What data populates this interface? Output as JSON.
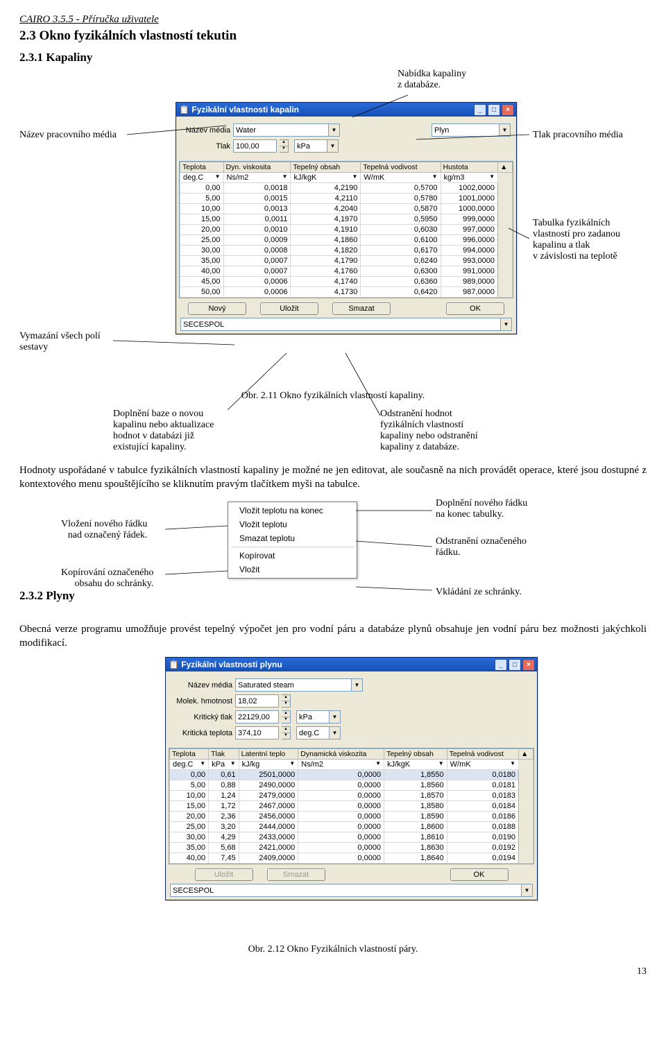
{
  "header": "CAIRO 3.5.5  - Příručka uživatele",
  "section_title": "2.3 Okno fyzikálních vlastností tekutin",
  "subsection_title": "2.3.1 Kapaliny",
  "callouts1": {
    "nabidka": "Nabídka kapaliny\nz databáze.",
    "nazev": "Název pracovního média",
    "tlak": "Tlak pracovního média",
    "tabulka": "Tabulka fyzikálních\nvlastností pro zadanou\nkapalinu a tlak\nv závislosti na teplotě",
    "vymazani": "Vymazání všech polí\nsestavy",
    "doplneni": "Doplnění baze o novou\nkapalinu nebo aktualizace\nhodnot v databázi již\nexistující kapaliny.",
    "odstraneni": "Odstranění hodnot\nfyzikálních vlastností\nkapaliny nebo odstranění\nkapaliny z databáze."
  },
  "win1": {
    "title": "Fyzikální vlastnosti kapalin",
    "nazev_lbl": "Název média",
    "nazev_val": "Water",
    "plyn_lbl": "Plyn",
    "tlak_lbl": "Tlak",
    "tlak_val": "100,00",
    "tlak_unit": "kPa",
    "cols": [
      "Teplota",
      "Dyn. viskosita",
      "Tepelný obsah",
      "Tepelná vodivost",
      "Hustota"
    ],
    "units": [
      "deg.C",
      "Ns/m2",
      "kJ/kgK",
      "W/mK",
      "kg/m3"
    ],
    "rows": [
      [
        "0,00",
        "0,0018",
        "4,2190",
        "0,5700",
        "1002,0000"
      ],
      [
        "5,00",
        "0,0015",
        "4,2110",
        "0,5780",
        "1001,0000"
      ],
      [
        "10,00",
        "0,0013",
        "4,2040",
        "0,5870",
        "1000,0000"
      ],
      [
        "15,00",
        "0,0011",
        "4,1970",
        "0,5950",
        "999,0000"
      ],
      [
        "20,00",
        "0,0010",
        "4,1910",
        "0,6030",
        "997,0000"
      ],
      [
        "25,00",
        "0,0009",
        "4,1860",
        "0,6100",
        "996,0000"
      ],
      [
        "30,00",
        "0,0008",
        "4,1820",
        "0,6170",
        "994,0000"
      ],
      [
        "35,00",
        "0,0007",
        "4,1790",
        "0,6240",
        "993,0000"
      ],
      [
        "40,00",
        "0,0007",
        "4,1760",
        "0,6300",
        "991,0000"
      ],
      [
        "45,00",
        "0,0006",
        "4,1740",
        "0,6360",
        "989,0000"
      ],
      [
        "50,00",
        "0,0006",
        "4,1730",
        "0,6420",
        "987,0000"
      ]
    ],
    "btn_novy": "Nový",
    "btn_ulozit": "Uložit",
    "btn_smazat": "Smazat",
    "btn_ok": "OK",
    "status": "SECESPOL"
  },
  "caption1": "Obr. 2.11 Okno fyzikálních vlastností kapaliny.",
  "body1": "Hodnoty uspořádané v tabulce fyzikálních vlastností kapaliny je možné ne jen editovat, ale současně na nich provádět operace, které jsou dostupné z kontextového menu spouštějícího se kliknutím pravým tlačítkem myši na tabulce.",
  "context": {
    "i1": "Vložit teplotu na konec",
    "i2": "Vložit teplotu",
    "i3": "Smazat teplotu",
    "i4": "Kopírovat",
    "i5": "Vložit"
  },
  "callouts2": {
    "vlozeni": "Vložení nového řádku\nnad označený řádek.",
    "kopir": "Kopírování označeného\nobsahu do schránky.",
    "doplneni": "Doplnění nového řádku\nna konec tabulky.",
    "odstr": "Odstranění označeného\nřádku.",
    "vklad": "Vkládání ze schránky."
  },
  "subsection2": "2.3.2 Plyny",
  "body2": "Obecná verze programu umožňuje provést tepelný výpočet jen pro vodní páru a databáze plynů obsahuje jen vodní páru bez možnosti jakýchkoli modifikací.",
  "win2": {
    "title": "Fyzikální vlastnosti plynu",
    "nazev_lbl": "Název média",
    "nazev_val": "Saturated steam",
    "molek_lbl": "Molek. hmotnost",
    "molek_val": "18,02",
    "krit_tlak_lbl": "Kritický tlak",
    "krit_tlak_val": "22129,00",
    "krit_tlak_unit": "kPa",
    "krit_tep_lbl": "Kritická teplota",
    "krit_tep_val": "374,10",
    "krit_tep_unit": "deg.C",
    "cols": [
      "Teplota",
      "Tlak",
      "Latentní teplo",
      "Dynamická viskozita",
      "Tepelný obsah",
      "Tepelná vodivost"
    ],
    "units": [
      "deg.C",
      "kPa",
      "kJ/kg",
      "Ns/m2",
      "kJ/kgK",
      "W/mK"
    ],
    "rows": [
      [
        "0,00",
        "0,61",
        "2501,0000",
        "0,0000",
        "1,8550",
        "0,0180"
      ],
      [
        "5,00",
        "0,88",
        "2490,0000",
        "0,0000",
        "1,8560",
        "0,0181"
      ],
      [
        "10,00",
        "1,24",
        "2479,0000",
        "0,0000",
        "1,8570",
        "0,0183"
      ],
      [
        "15,00",
        "1,72",
        "2467,0000",
        "0,0000",
        "1,8580",
        "0,0184"
      ],
      [
        "20,00",
        "2,36",
        "2456,0000",
        "0,0000",
        "1,8590",
        "0,0186"
      ],
      [
        "25,00",
        "3,20",
        "2444,0000",
        "0,0000",
        "1,8600",
        "0,0188"
      ],
      [
        "30,00",
        "4,29",
        "2433,0000",
        "0,0000",
        "1,8610",
        "0,0190"
      ],
      [
        "35,00",
        "5,68",
        "2421,0000",
        "0,0000",
        "1,8630",
        "0,0192"
      ],
      [
        "40,00",
        "7,45",
        "2409,0000",
        "0,0000",
        "1,8640",
        "0,0194"
      ]
    ],
    "btn_ulozit": "Uložit",
    "btn_smazat": "Smazat",
    "btn_ok": "OK",
    "status": "SECESPOL"
  },
  "caption2": "Obr. 2.12 Okno Fyzikálních vlastností páry.",
  "pagenum": "13"
}
